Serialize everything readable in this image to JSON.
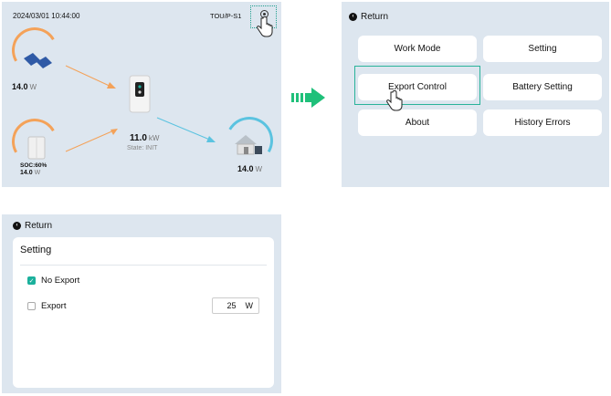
{
  "dashboard": {
    "timestamp": "2024/03/01 10:44:00",
    "mode_label": "TOU/P-S1",
    "pv": {
      "value": "14.0",
      "unit": "W"
    },
    "battery": {
      "soc": "SOC:60%",
      "value": "14.0",
      "unit": "W"
    },
    "inverter": {
      "value": "11.0",
      "unit": "kW",
      "state": "State: INIT"
    },
    "load": {
      "value": "14.0",
      "unit": "W"
    },
    "colors": {
      "pv_flow": "#f4a259",
      "load_flow": "#5bc3e0",
      "accent": "#1bb09c"
    }
  },
  "menu": {
    "return_label": "Return",
    "buttons": [
      "Work Mode",
      "Setting",
      "Export Control",
      "Battery Setting",
      "About",
      "History Errors"
    ],
    "highlighted": "Export Control"
  },
  "setting": {
    "return_label": "Return",
    "title": "Setting",
    "options": [
      {
        "label": "No Export",
        "checked": true
      },
      {
        "label": "Export",
        "checked": false
      }
    ],
    "export_power": {
      "value": "25",
      "unit": "W"
    }
  },
  "icons": [
    "gear-icon",
    "hand-pointer-icon",
    "solar-panel-icon",
    "battery-icon",
    "inverter-icon",
    "house-icon",
    "arrow-right-icon",
    "back-icon",
    "checkbox-checked-icon",
    "checkbox-empty-icon"
  ]
}
